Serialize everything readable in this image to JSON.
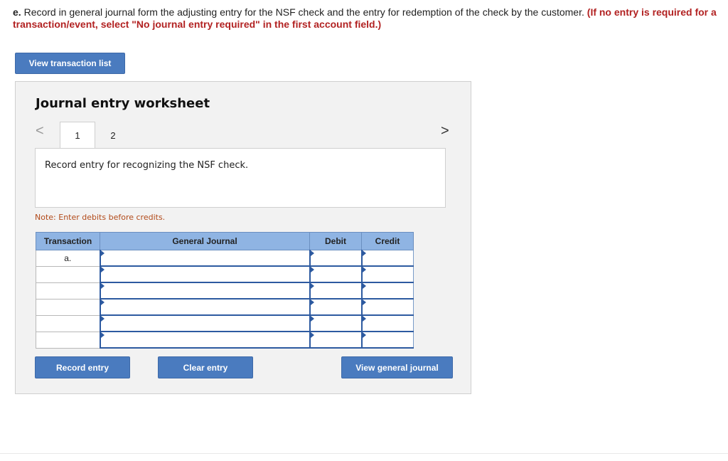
{
  "instructions": {
    "part": "e.",
    "text": " Record in general journal form the adjusting entry for the NSF check and the entry for redemption of the check by the customer. ",
    "hint": "(If no entry is required for a transaction/event, select \"No journal entry required\" in the first account field.)"
  },
  "buttons": {
    "view_transaction_list": "View transaction list",
    "record_entry": "Record entry",
    "clear_entry": "Clear entry",
    "view_general_journal": "View general journal"
  },
  "worksheet": {
    "title": "Journal entry worksheet",
    "nav_prev": "<",
    "nav_next": ">",
    "tabs": [
      "1",
      "2"
    ],
    "description": "Record entry for recognizing the NSF check.",
    "note": "Note: Enter debits before credits."
  },
  "table": {
    "headers": [
      "Transaction",
      "General Journal",
      "Debit",
      "Credit"
    ],
    "rows": [
      {
        "transaction": "a.",
        "account": "",
        "debit": "",
        "credit": ""
      },
      {
        "transaction": "",
        "account": "",
        "debit": "",
        "credit": ""
      },
      {
        "transaction": "",
        "account": "",
        "debit": "",
        "credit": ""
      },
      {
        "transaction": "",
        "account": "",
        "debit": "",
        "credit": ""
      },
      {
        "transaction": "",
        "account": "",
        "debit": "",
        "credit": ""
      },
      {
        "transaction": "",
        "account": "",
        "debit": "",
        "credit": ""
      }
    ]
  }
}
